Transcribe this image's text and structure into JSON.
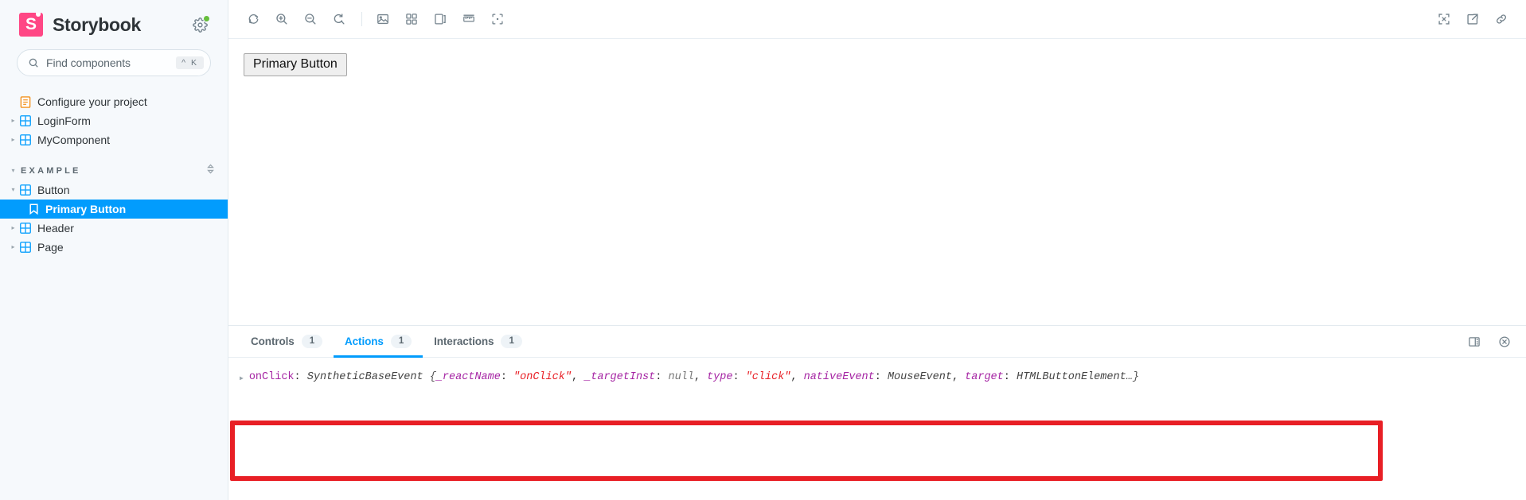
{
  "brand": {
    "name": "Storybook",
    "logo_icon": "storybook-logo-icon",
    "settings_icon": "gear-icon",
    "status_dot_color": "#66bf3c"
  },
  "search": {
    "placeholder": "Find components",
    "shortcut": "^ K",
    "icon": "search-icon"
  },
  "sidebar": {
    "items": [
      {
        "label": "Configure your project",
        "icon": "document-icon",
        "level": 0,
        "caret": "none",
        "selected": false
      },
      {
        "label": "LoginForm",
        "icon": "component-grid-icon",
        "level": 0,
        "caret": "collapsed",
        "selected": false
      },
      {
        "label": "MyComponent",
        "icon": "component-grid-icon",
        "level": 0,
        "caret": "collapsed",
        "selected": false
      }
    ],
    "group": {
      "title": "EXAMPLE",
      "caret": "expanded",
      "sort_icon": "sort-chevrons-icon",
      "items": [
        {
          "label": "Button",
          "icon": "component-grid-icon",
          "level": 0,
          "caret": "expanded",
          "selected": false
        },
        {
          "label": "Primary Button",
          "icon": "story-bookmark-icon",
          "level": 1,
          "caret": "none",
          "selected": true
        },
        {
          "label": "Header",
          "icon": "component-grid-icon",
          "level": 0,
          "caret": "collapsed",
          "selected": false
        },
        {
          "label": "Page",
          "icon": "component-grid-icon",
          "level": 0,
          "caret": "collapsed",
          "selected": false
        }
      ]
    }
  },
  "toolbar": {
    "left_buttons": [
      {
        "name": "remount-icon",
        "title": "Remount component"
      },
      {
        "name": "zoom-in-icon",
        "title": "Zoom in"
      },
      {
        "name": "zoom-out-icon",
        "title": "Zoom out"
      },
      {
        "name": "zoom-reset-icon",
        "title": "Reset zoom"
      }
    ],
    "left_buttons_group2": [
      {
        "name": "background-image-icon",
        "title": "Change background"
      },
      {
        "name": "grid-icon",
        "title": "Apply grid"
      },
      {
        "name": "viewport-icon",
        "title": "Change viewport"
      },
      {
        "name": "measure-icon",
        "title": "Enable measure"
      },
      {
        "name": "outline-icon",
        "title": "Apply outlines"
      }
    ],
    "right_buttons": [
      {
        "name": "fullscreen-icon",
        "title": "Go full screen"
      },
      {
        "name": "open-new-tab-icon",
        "title": "Open canvas in new tab"
      },
      {
        "name": "copy-link-icon",
        "title": "Copy canvas link"
      }
    ]
  },
  "canvas": {
    "button_label": "Primary Button"
  },
  "addons": {
    "tabs": [
      {
        "label": "Controls",
        "badge": "1",
        "active": false
      },
      {
        "label": "Actions",
        "badge": "1",
        "active": true
      },
      {
        "label": "Interactions",
        "badge": "1",
        "active": false
      }
    ],
    "right_buttons": [
      {
        "name": "panel-position-icon",
        "title": "Change addon orientation"
      },
      {
        "name": "close-addon-panel-icon",
        "title": "Hide addons"
      }
    ],
    "accent_color": "#029cfd"
  },
  "action_log": {
    "expander_icon": "triangle-right-icon",
    "highlight_color": "#e81f25",
    "entry": {
      "key": "onClick",
      "separator": ": ",
      "constructor": "SyntheticBaseEvent",
      "open_brace": "{",
      "props": [
        {
          "key": "_reactName",
          "value": "\"onClick\"",
          "value_type": "string"
        },
        {
          "key": "_targetInst",
          "value": "null",
          "value_type": "null"
        },
        {
          "key": "type",
          "value": "\"click\"",
          "value_type": "string"
        },
        {
          "key": "nativeEvent",
          "value": "MouseEvent",
          "value_type": "ctor"
        },
        {
          "key": "target",
          "value": "HTMLButtonElement",
          "value_type": "ctor"
        }
      ],
      "ellipsis": "…",
      "close_brace": "}",
      "comma": ", "
    }
  }
}
